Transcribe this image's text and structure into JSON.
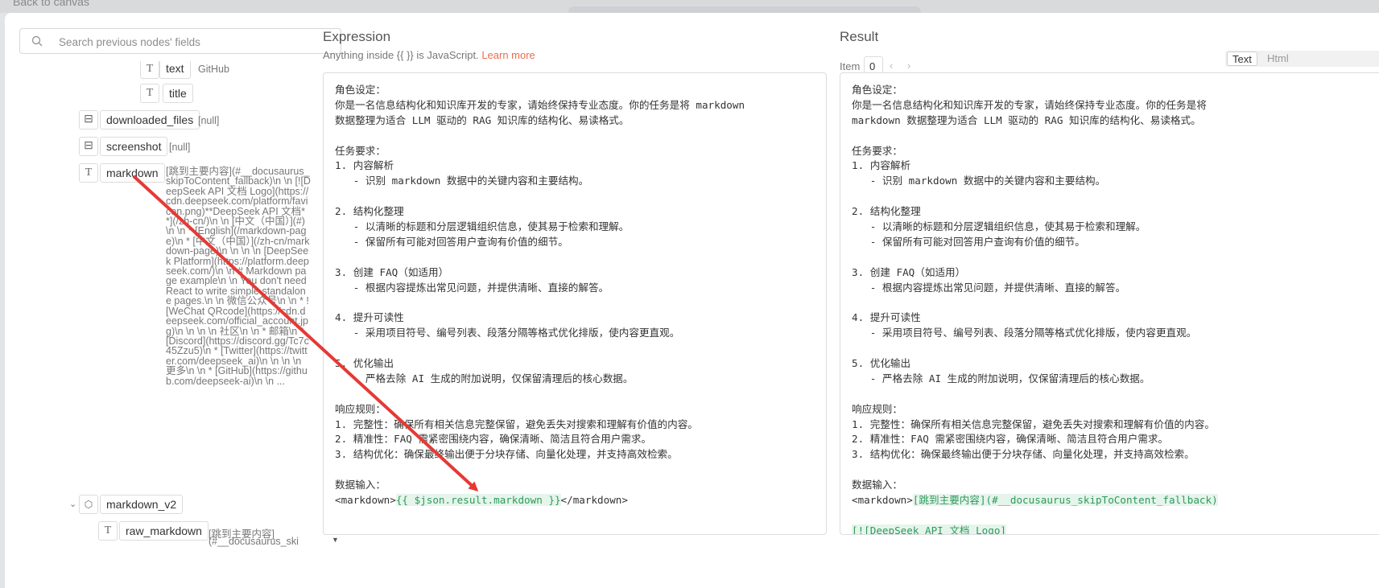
{
  "top": {
    "back_label": "Back to canvas"
  },
  "search": {
    "placeholder": "Search previous nodes' fields"
  },
  "tree": {
    "text_field": {
      "name": "text",
      "value": "GitHub"
    },
    "title_field": {
      "name": "title"
    },
    "downloaded_files": {
      "name": "downloaded_files",
      "value": "[null]"
    },
    "screenshot": {
      "name": "screenshot",
      "value": "[null]"
    },
    "markdown": {
      "name": "markdown",
      "value": "[跳到主要内容](#__docusaurus_skipToContent_fallback)\\n \\n [![DeepSeek API 文档 Logo](https://cdn.deepseek.com/platform/favicon.png)**DeepSeek API 文档**](/zh-cn/)\\n \\n [中文（中国）](#)\\n \\n * [English](/markdown-page)\\n * [中文（中国）](/zh-cn/markdown-page)\\n \\n \\n \\n [DeepSeek Platform](https://platform.deepseek.com/)\\n \\n # Markdown page example\\n \\n You don't need React to write simple standalone pages.\\n \\n 微信公众号\\n \\n * ![WeChat QRcode](https://cdn.deepseek.com/official_account.jpg)\\n \\n \\n \\n 社区\\n \\n * 邮箱\\n * [Discord](https://discord.gg/Tc7c45Zzu5)\\n * [Twitter](https://twitter.com/deepseek_ai)\\n \\n \\n \\n 更多\\n \\n * [GitHub](https://github.com/deepseek-ai)\\n \\n ..."
    },
    "markdown_v2": {
      "name": "markdown_v2"
    },
    "raw_markdown": {
      "name": "raw_markdown",
      "value_line1": "[跳到主要内容]",
      "value_line2": "(#__docusaurus_ski"
    }
  },
  "expression": {
    "title": "Expression",
    "subtitle_prefix": "Anything inside {{ }} is JavaScript.",
    "learn_more": "Learn more",
    "lines": [
      "角色设定：",
      "你是一名信息结构化和知识库开发的专家，请始终保持专业态度。你的任务是将 markdown",
      "数据整理为适合 LLM 驱动的 RAG 知识库的结构化、易读格式。",
      "",
      "任务要求：",
      "1. 内容解析",
      "   - 识别 markdown 数据中的关键内容和主要结构。",
      "",
      "2. 结构化整理",
      "   - 以清晰的标题和分层逻辑组织信息，使其易于检索和理解。",
      "   - 保留所有可能对回答用户查询有价值的细节。",
      "",
      "3. 创建 FAQ（如适用）",
      "   - 根据内容提炼出常见问题，并提供清晰、直接的解答。",
      "",
      "4. 提升可读性",
      "   - 采用项目符号、编号列表、段落分隔等格式优化排版，使内容更直观。",
      "",
      "5. 优化输出",
      "   - 严格去除 AI 生成的附加说明，仅保留清理后的核心数据。",
      "",
      "响应规则：",
      "1. 完整性：确保所有相关信息完整保留，避免丢失对搜索和理解有价值的内容。",
      "2. 精准性：FAQ 需紧密围绕内容，确保清晰、简洁且符合用户需求。",
      "3. 结构优化：确保最终输出便于分块存储、向量化处理，并支持高效检索。",
      "",
      "数据输入："
    ],
    "last_line": {
      "prefix": "<markdown>",
      "expr": "{{ $json.result.markdown }}",
      "suffix": "</markdown>"
    }
  },
  "result": {
    "title": "Result",
    "item_label": "Item",
    "item_value": "0",
    "toggle_on": "Text",
    "toggle_off": "Html",
    "lines": [
      "角色设定：",
      "你是一名信息结构化和知识库开发的专家，请始终保持专业态度。你的任务是将",
      "markdown 数据整理为适合 LLM 驱动的 RAG 知识库的结构化、易读格式。",
      "",
      "任务要求：",
      "1. 内容解析",
      "   - 识别 markdown 数据中的关键内容和主要结构。",
      "",
      "2. 结构化整理",
      "   - 以清晰的标题和分层逻辑组织信息，使其易于检索和理解。",
      "   - 保留所有可能对回答用户查询有价值的细节。",
      "",
      "3. 创建 FAQ（如适用）",
      "   - 根据内容提炼出常见问题，并提供清晰、直接的解答。",
      "",
      "4. 提升可读性",
      "   - 采用项目符号、编号列表、段落分隔等格式优化排版，使内容更直观。",
      "",
      "5. 优化输出",
      "   - 严格去除 AI 生成的附加说明，仅保留清理后的核心数据。",
      "",
      "响应规则：",
      "1. 完整性：确保所有相关信息完整保留，避免丢失对搜索和理解有价值的内容。",
      "2. 精准性：FAQ 需紧密围绕内容，确保清晰、简洁且符合用户需求。",
      "3. 结构优化：确保最终输出便于分块存储、向量化处理，并支持高效检索。",
      "",
      "数据输入："
    ],
    "last_line": {
      "prefix": "<markdown>",
      "resolved": "[跳到主要内容](#__docusaurus_skipToContent_fallback)"
    },
    "extra_line": "[![DeepSeek API 文档 Logo]"
  },
  "colors": {
    "accent": "#ea6c50",
    "highlight_bg": "#e6f5ec",
    "highlight_fg": "#2e9a5b",
    "arrow": "#e53935"
  }
}
